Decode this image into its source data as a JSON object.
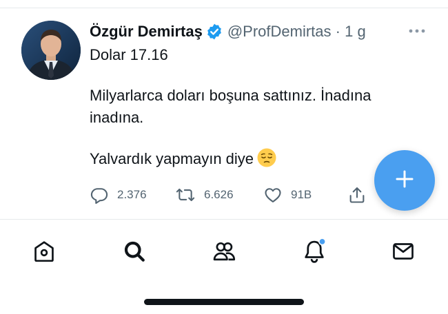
{
  "tweet": {
    "author_name": "Özgür Demirtaş",
    "verified": true,
    "handle": "@ProfDemirtas",
    "separator": "·",
    "time": "1 g",
    "text_line1": "Dolar 17.16",
    "text_line2": "Milyarlarca doları boşuna sattınız. İnadına inadına.",
    "text_line3": "Yalvardık yapmayın diye",
    "emoji": "pensive-face",
    "replies": "2.376",
    "retweets": "6.626",
    "likes": "91B"
  },
  "nav": {
    "items": [
      "home",
      "search",
      "communities",
      "notifications",
      "messages"
    ],
    "notifications_dot": true
  },
  "colors": {
    "accent": "#4a9ff0",
    "text": "#0f1419",
    "muted": "#536471",
    "verified": "#1d9bf0"
  }
}
